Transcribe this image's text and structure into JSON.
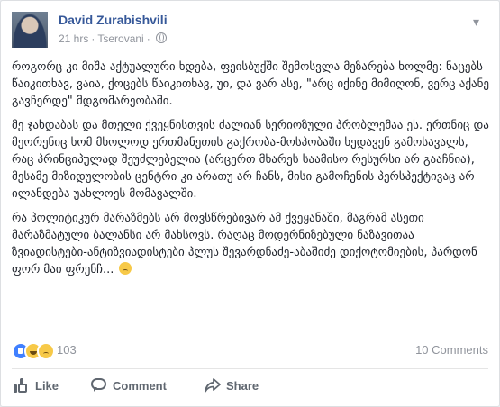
{
  "post": {
    "author": "David Zurabishvili",
    "time": "21 hrs",
    "separator": "·",
    "location": "Tserovani",
    "privacy_icon": "globe-icon",
    "more_icon": "chevron-down-icon",
    "paragraphs": [
      "როგორც კი მიშა აქტუალური ხდება, ფეისბუქში შემოსვლა მეზარება ხოლმე: ნაცებს წაიკითხავ, ვაია, ქოცებს წაიკითხავ, უი, და ვარ ასე, \"არც იქინე მიმიღონ, ვერც აქანე გავჩერდე\" მდგომარეობაში.",
      "მე ჯახდაბას და მთელი ქვეყნისთვის ძალიან სერიოზული პრობლემაა ეს. ერთნიც და მეორენიც ხომ მხოლოდ ერთმანეთის გაქრობა-მოსპობაში ხედავენ გამოსავალს, რაც პრინციპულად შეუძლებელია (არცერთ მხარეს საამისო რესურსი არ გააჩნია), მესამე მიზიდულობის ცენტრი კი არათუ არ ჩანს, მისი გამოჩენის პერსპექტივაც არ ილანდება უახლოეს მომავალში.",
      "რა პოლიტიკურ მარაზმებს არ მოვსწრებივარ ამ ქვეყანაში, მაგრამ ასეთი მარაზმატული ბალანსი არ მახსოვს. რაღაც მოდერნიზებული ნაზავითაა ზვიადისტები-ანტიზვიადისტები პლუს შევარდნაძე-აბაშიძე დიქოტომიების, პარდონ ფორ მაი ფრენჩ..."
    ],
    "emoji_icon": "sad-face-icon"
  },
  "stats": {
    "reactions_count": "103",
    "comments_count": "10 Comments",
    "reaction_icons": [
      "like-icon",
      "haha-icon",
      "sad-icon"
    ]
  },
  "actions": {
    "like": "Like",
    "comment": "Comment",
    "share": "Share"
  },
  "colors": {
    "author_link": "#365899",
    "meta_text": "#90949c",
    "like_blue": "#4080ff"
  }
}
